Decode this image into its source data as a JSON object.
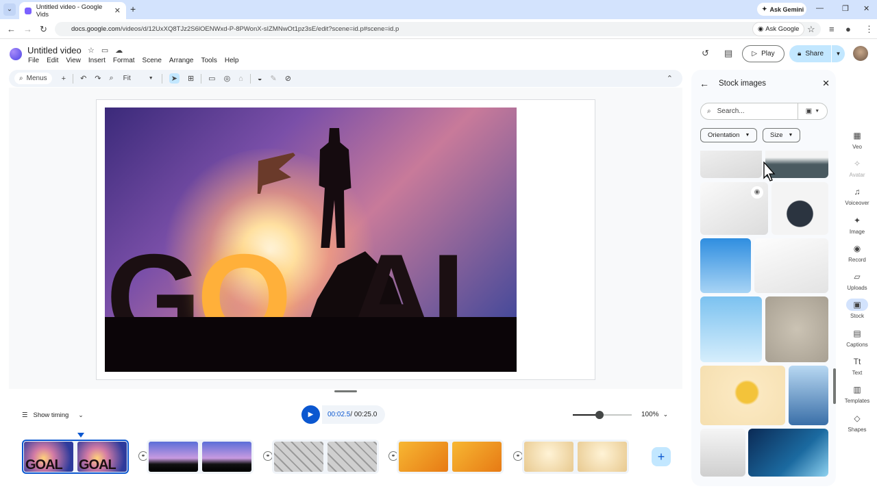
{
  "browser": {
    "tab_title": "Untitled video - Google Vids",
    "new_tab": "+",
    "ask_gemini": "Ask Gemini",
    "url_host": "docs.google.com",
    "url_path": "/videos/d/12UxXQ8TJz2S6lOENWxd-P-8PWonX-sIZMNwOt1pz3sE/edit?scene=id.p#scene=id.p",
    "ask_google": "Ask Google"
  },
  "app": {
    "doc_title": "Untitled video",
    "menu": [
      "File",
      "Edit",
      "View",
      "Insert",
      "Format",
      "Scene",
      "Arrange",
      "Tools",
      "Help"
    ],
    "play_label": "Play",
    "share_label": "Share"
  },
  "toolbar": {
    "menus_label": "Menus",
    "zoom_label": "Fit"
  },
  "player": {
    "show_timing": "Show timing",
    "current_time": "00:02.5",
    "total_time": " / 00:25.0",
    "zoom_percent": "100%",
    "zoom_level": 0.45
  },
  "timeline": {
    "scenes": [
      {
        "frames": [
          "goal",
          "goal"
        ],
        "active": true
      },
      {
        "frames": [
          "team",
          "team"
        ],
        "active": false
      },
      {
        "frames": [
          "keys",
          "keys"
        ],
        "active": false
      },
      {
        "frames": [
          "dart",
          "dart"
        ],
        "active": false
      },
      {
        "frames": [
          "star",
          "star"
        ],
        "active": false
      }
    ]
  },
  "slide": {
    "image_text": "GOAL"
  },
  "stock_panel": {
    "title": "Stock images",
    "search_placeholder": "Search...",
    "filters": [
      "Orientation",
      "Size"
    ]
  },
  "rail": {
    "items": [
      {
        "label": "Veo",
        "icon": "veo-icon"
      },
      {
        "label": "Avatar",
        "icon": "avatar-icon"
      },
      {
        "label": "Voiceover",
        "icon": "voiceover-icon"
      },
      {
        "label": "Image",
        "icon": "image-icon"
      },
      {
        "label": "Record",
        "icon": "record-icon"
      },
      {
        "label": "Uploads",
        "icon": "uploads-icon"
      },
      {
        "label": "Stock",
        "icon": "stock-icon"
      },
      {
        "label": "Captions",
        "icon": "captions-icon"
      },
      {
        "label": "Text",
        "icon": "text-icon"
      },
      {
        "label": "Templates",
        "icon": "templates-icon"
      },
      {
        "label": "Shapes",
        "icon": "shapes-icon"
      }
    ]
  },
  "colors": {
    "accent": "#0b57d0",
    "chrome": "#d3e3fd",
    "share": "#c2e7ff"
  }
}
